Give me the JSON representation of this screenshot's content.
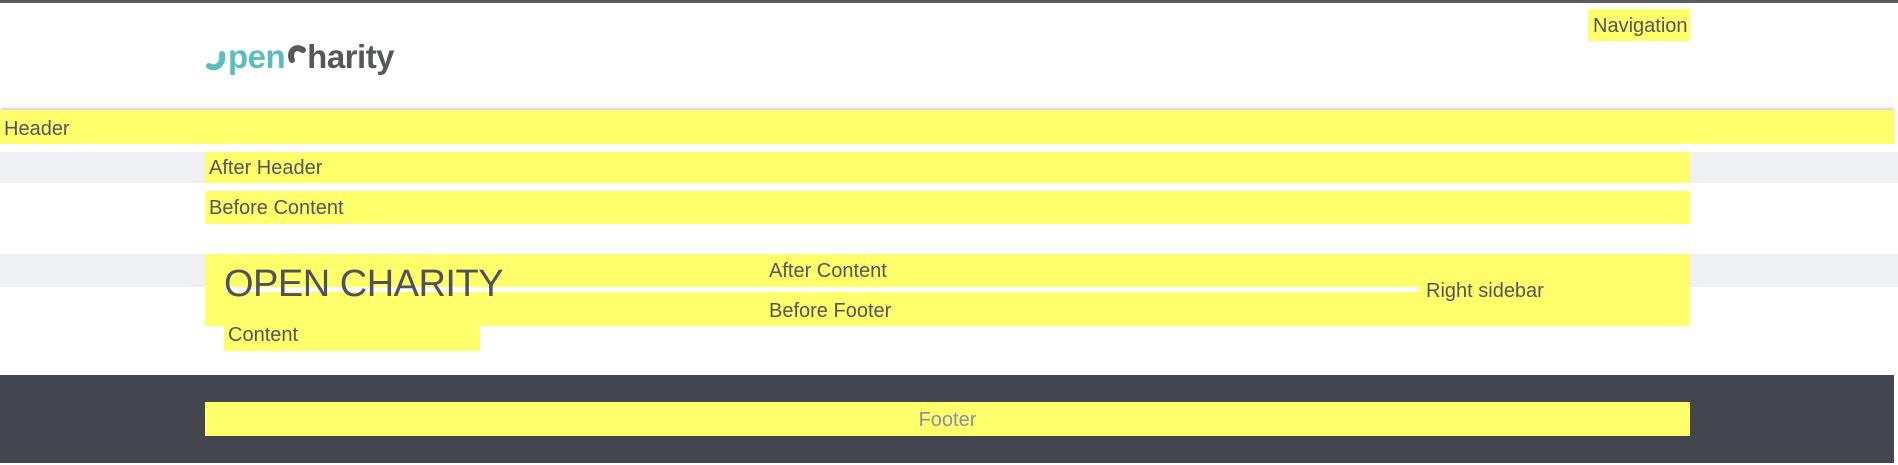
{
  "logo": {
    "part1": "pen",
    "part2": "harity",
    "alt": "OpenCharity"
  },
  "regions": {
    "navigation": "Navigation",
    "header": "Header",
    "after_header": "After Header",
    "before_content": "Before Content",
    "page_title": "OPEN CHARITY",
    "content": "Content",
    "after_content": "After Content",
    "before_footer": "Before Footer",
    "right_sidebar": "Right sidebar",
    "footer": "Footer"
  },
  "colors": {
    "region_highlight": "#ffff6b",
    "logo_teal": "#5bbdbd",
    "logo_grey": "#56575c",
    "footer_bg": "#43464e",
    "band_bg": "#eff0f3"
  }
}
